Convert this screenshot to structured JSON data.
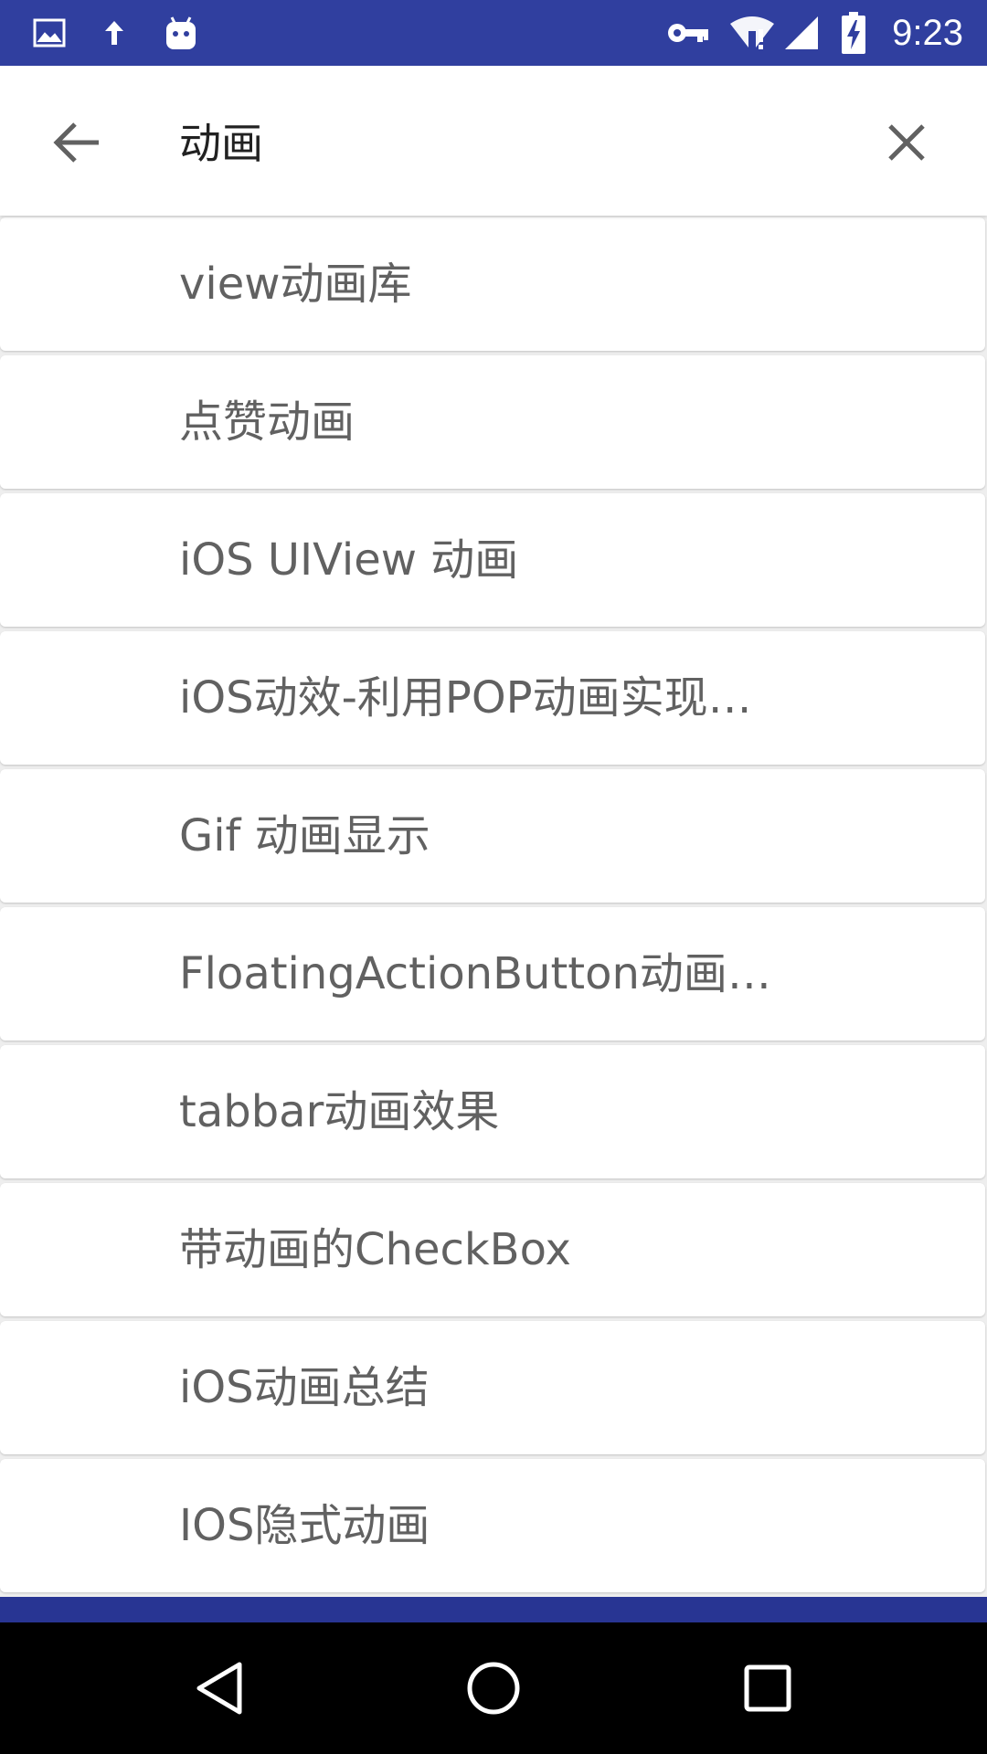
{
  "status_bar": {
    "time": "9:23",
    "background_color": "#303f9f",
    "icons_left": [
      "image-icon",
      "upload-arrow-icon",
      "android-robot-icon"
    ],
    "icons_right": [
      "vpn-key-icon",
      "wifi-alert-icon",
      "cell-signal-icon",
      "battery-charging-icon"
    ]
  },
  "search": {
    "query": "动画",
    "back_icon": "arrow-back-icon",
    "clear_icon": "close-icon"
  },
  "results": [
    {
      "label": "view动画库"
    },
    {
      "label": "点赞动画"
    },
    {
      "label": "iOS UIView 动画"
    },
    {
      "label": "iOS动效-利用POP动画实现…"
    },
    {
      "label": "Gif 动画显示"
    },
    {
      "label": "FloatingActionButton动画…"
    },
    {
      "label": "tabbar动画效果"
    },
    {
      "label": "带动画的CheckBox"
    },
    {
      "label": "iOS动画总结"
    },
    {
      "label": "IOS隐式动画"
    }
  ],
  "nav_bar": {
    "back": "nav-back-triangle-icon",
    "home": "nav-home-circle-icon",
    "recents": "nav-recents-square-icon"
  },
  "colors": {
    "accent": "#303f9f",
    "accent_dark": "#283593",
    "text_primary": "#212121",
    "text_secondary": "#616161",
    "list_background": "#eeeeee"
  }
}
